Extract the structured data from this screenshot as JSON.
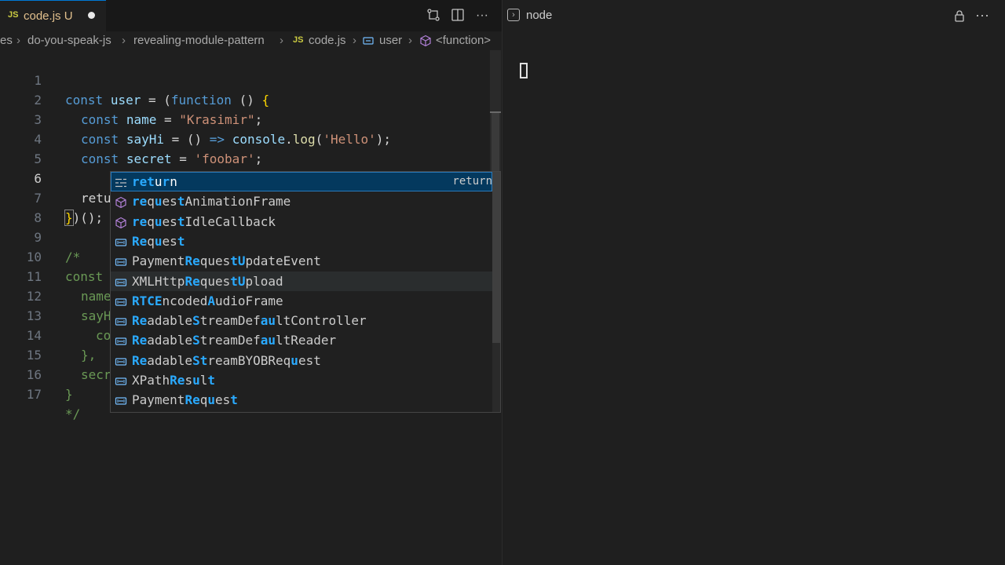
{
  "editor": {
    "tab": {
      "lang_badge": "JS",
      "filename": "code.js",
      "status": "U"
    },
    "breadcrumb": [
      "es",
      "do-you-speak-js",
      "revealing-module-pattern",
      "code.js",
      "user",
      "<function>"
    ],
    "breadcrumb_js_badge": "JS",
    "lines": [
      {
        "n": "1"
      },
      {
        "n": "2"
      },
      {
        "n": "3"
      },
      {
        "n": "4"
      },
      {
        "n": "5"
      },
      {
        "n": "6"
      },
      {
        "n": "7"
      },
      {
        "n": "8"
      },
      {
        "n": "9"
      },
      {
        "n": "10"
      },
      {
        "n": "11"
      },
      {
        "n": "12"
      },
      {
        "n": "13"
      },
      {
        "n": "14"
      },
      {
        "n": "15"
      },
      {
        "n": "16"
      },
      {
        "n": "17"
      }
    ],
    "code": {
      "l1_const": "const",
      "l1_user": "user",
      "l1_rest1": " = (",
      "l1_function": "function",
      "l1_rest2": " () ",
      "l1_brace": "{",
      "l2_const": "const",
      "l2_name": "name",
      "l2_eq": " = ",
      "l2_str": "\"Krasimir\"",
      "l2_semi": ";",
      "l3_const": "const",
      "l3_sayhi": "sayHi",
      "l3_eq": " = () ",
      "l3_arrow": "=>",
      "l3_console": "console",
      "l3_dot": ".",
      "l3_log": "log",
      "l3_p1": "(",
      "l3_str": "'Hello'",
      "l3_p2": ");",
      "l4_const": "const",
      "l4_secret": "secret",
      "l4_eq": " = ",
      "l4_str": "'foobar'",
      "l4_semi": ";",
      "l6_typed": "retu",
      "l7_brace": "}",
      "l7_rest": ")();",
      "l9": "/*",
      "l10": "const",
      "l11": "name",
      "l12": "sayH",
      "l13": "co",
      "l14": "},",
      "l15": "secr",
      "l16": "}",
      "l17": "*/"
    }
  },
  "suggestions": {
    "items": [
      {
        "kind": "keyword",
        "parts": [
          [
            "ret",
            1
          ],
          [
            "u",
            0
          ],
          [
            "r",
            1
          ],
          [
            "n",
            0
          ]
        ],
        "detail": "return"
      },
      {
        "kind": "method",
        "parts": [
          [
            "re",
            1
          ],
          [
            "q",
            0
          ],
          [
            "u",
            1
          ],
          [
            "es",
            0
          ],
          [
            "t",
            1
          ],
          [
            "AnimationFrame",
            0
          ]
        ]
      },
      {
        "kind": "method",
        "parts": [
          [
            "re",
            1
          ],
          [
            "q",
            0
          ],
          [
            "u",
            1
          ],
          [
            "es",
            0
          ],
          [
            "t",
            1
          ],
          [
            "IdleCallback",
            0
          ]
        ]
      },
      {
        "kind": "variable",
        "parts": [
          [
            "Re",
            1
          ],
          [
            "q",
            0
          ],
          [
            "u",
            1
          ],
          [
            "es",
            0
          ],
          [
            "t",
            1
          ]
        ]
      },
      {
        "kind": "variable",
        "parts": [
          [
            "Payment",
            0
          ],
          [
            "Re",
            1
          ],
          [
            "ques",
            0
          ],
          [
            "tU",
            1
          ],
          [
            "pdateEvent",
            0
          ]
        ]
      },
      {
        "kind": "variable",
        "parts": [
          [
            "XMLHttp",
            0
          ],
          [
            "Re",
            1
          ],
          [
            "ques",
            0
          ],
          [
            "tU",
            1
          ],
          [
            "pload",
            0
          ]
        ]
      },
      {
        "kind": "variable",
        "parts": [
          [
            "RTCE",
            1
          ],
          [
            "ncoded",
            0
          ],
          [
            "A",
            1
          ],
          [
            "udioFrame",
            0
          ]
        ]
      },
      {
        "kind": "variable",
        "parts": [
          [
            "Re",
            1
          ],
          [
            "adable",
            0
          ],
          [
            "S",
            1
          ],
          [
            "treamDef",
            0
          ],
          [
            "au",
            1
          ],
          [
            "ltController",
            0
          ]
        ]
      },
      {
        "kind": "variable",
        "parts": [
          [
            "Re",
            1
          ],
          [
            "adable",
            0
          ],
          [
            "S",
            1
          ],
          [
            "treamDef",
            0
          ],
          [
            "au",
            1
          ],
          [
            "ltReader",
            0
          ]
        ]
      },
      {
        "kind": "variable",
        "parts": [
          [
            "Re",
            1
          ],
          [
            "adable",
            0
          ],
          [
            "St",
            1
          ],
          [
            "reamBYOBReq",
            0
          ],
          [
            "u",
            1
          ],
          [
            "est",
            0
          ]
        ]
      },
      {
        "kind": "variable",
        "parts": [
          [
            "XPath",
            0
          ],
          [
            "Re",
            1
          ],
          [
            "s",
            0
          ],
          [
            "u",
            1
          ],
          [
            "l",
            0
          ],
          [
            "t",
            1
          ]
        ]
      },
      {
        "kind": "variable",
        "parts": [
          [
            "Payment",
            0
          ],
          [
            "Re",
            1
          ],
          [
            "q",
            0
          ],
          [
            "u",
            1
          ],
          [
            "es",
            0
          ],
          [
            "t",
            1
          ]
        ]
      }
    ],
    "selected_index": 0,
    "hovered_index": 5,
    "highlight_color": "#2aaaff"
  },
  "terminal": {
    "name": "node"
  }
}
